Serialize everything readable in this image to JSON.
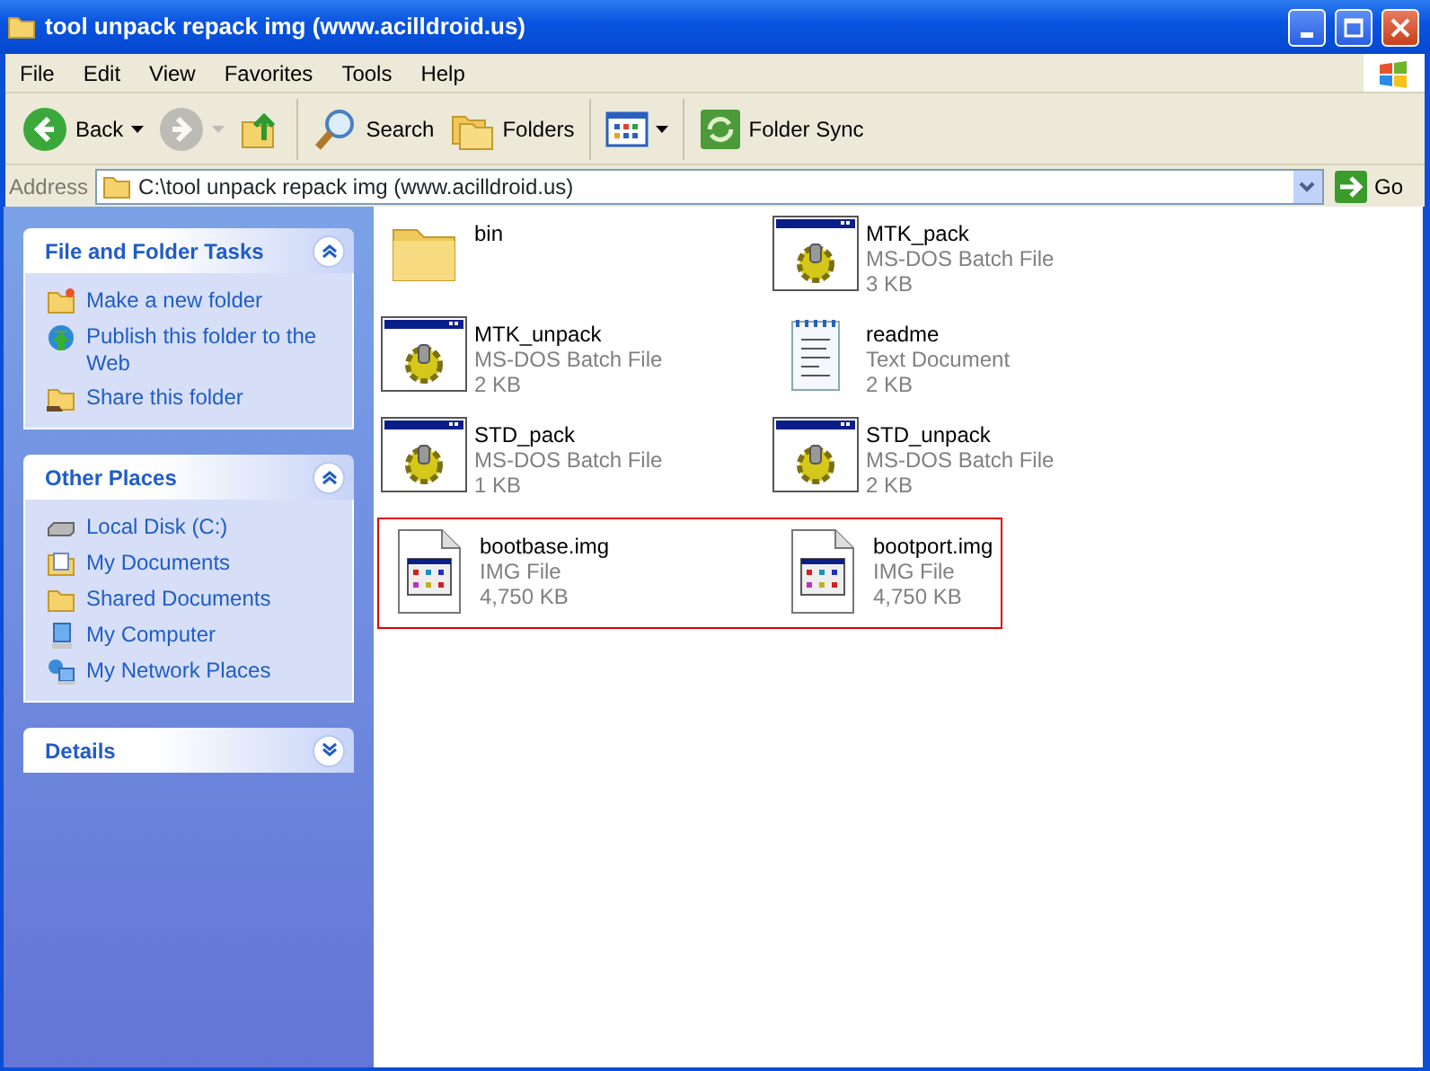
{
  "window": {
    "title": "tool unpack repack img (www.acilldroid.us)"
  },
  "menu": [
    "File",
    "Edit",
    "View",
    "Favorites",
    "Tools",
    "Help"
  ],
  "toolbar": [
    {
      "kind": "back",
      "label": "Back",
      "disabled": false,
      "caret": true
    },
    {
      "kind": "forward",
      "disabled": true,
      "caret": true
    },
    {
      "kind": "up",
      "disabled": false,
      "caret": false
    },
    {
      "kind": "search",
      "label": "Search",
      "disabled": false,
      "caret": false
    },
    {
      "kind": "folders",
      "label": "Folders",
      "disabled": false,
      "caret": false
    },
    {
      "kind": "views",
      "disabled": false,
      "caret": true
    },
    {
      "kind": "sync",
      "label": "Folder Sync",
      "disabled": false,
      "caret": false
    }
  ],
  "address": {
    "label": "Address",
    "value": "C:\\tool unpack repack img (www.acilldroid.us)",
    "go": "Go"
  },
  "panes": [
    {
      "title": "File and Folder Tasks",
      "expanded": true,
      "items": [
        {
          "kind": "new-folder",
          "label": "Make a new folder"
        },
        {
          "kind": "publish",
          "label": "Publish this folder to the Web"
        },
        {
          "kind": "share",
          "label": "Share this folder"
        }
      ]
    },
    {
      "title": "Other Places",
      "expanded": true,
      "items": [
        {
          "kind": "disk",
          "label": "Local Disk (C:)"
        },
        {
          "kind": "documents",
          "label": "My Documents"
        },
        {
          "kind": "folder",
          "label": "Shared Documents"
        },
        {
          "kind": "computer",
          "label": "My Computer"
        },
        {
          "kind": "network",
          "label": "My Network Places"
        }
      ]
    },
    {
      "title": "Details",
      "expanded": false
    }
  ],
  "files": [
    {
      "kind": "folder",
      "name": "bin",
      "highlighted": false
    },
    {
      "kind": "batch",
      "name": "MTK_pack",
      "type": "MS-DOS Batch File",
      "size": "3 KB",
      "highlighted": false
    },
    {
      "kind": "batch",
      "name": "MTK_unpack",
      "type": "MS-DOS Batch File",
      "size": "2 KB",
      "highlighted": false
    },
    {
      "kind": "text",
      "name": "readme",
      "type": "Text Document",
      "size": "2 KB",
      "highlighted": false
    },
    {
      "kind": "batch",
      "name": "STD_pack",
      "type": "MS-DOS Batch File",
      "size": "1 KB",
      "highlighted": false
    },
    {
      "kind": "batch",
      "name": "STD_unpack",
      "type": "MS-DOS Batch File",
      "size": "2 KB",
      "highlighted": false
    },
    {
      "kind": "image",
      "name": "bootbase.img",
      "type": "IMG File",
      "size": "4,750 KB",
      "highlighted": true
    },
    {
      "kind": "image",
      "name": "bootport.img",
      "type": "IMG File",
      "size": "4,750 KB",
      "highlighted": true
    }
  ]
}
